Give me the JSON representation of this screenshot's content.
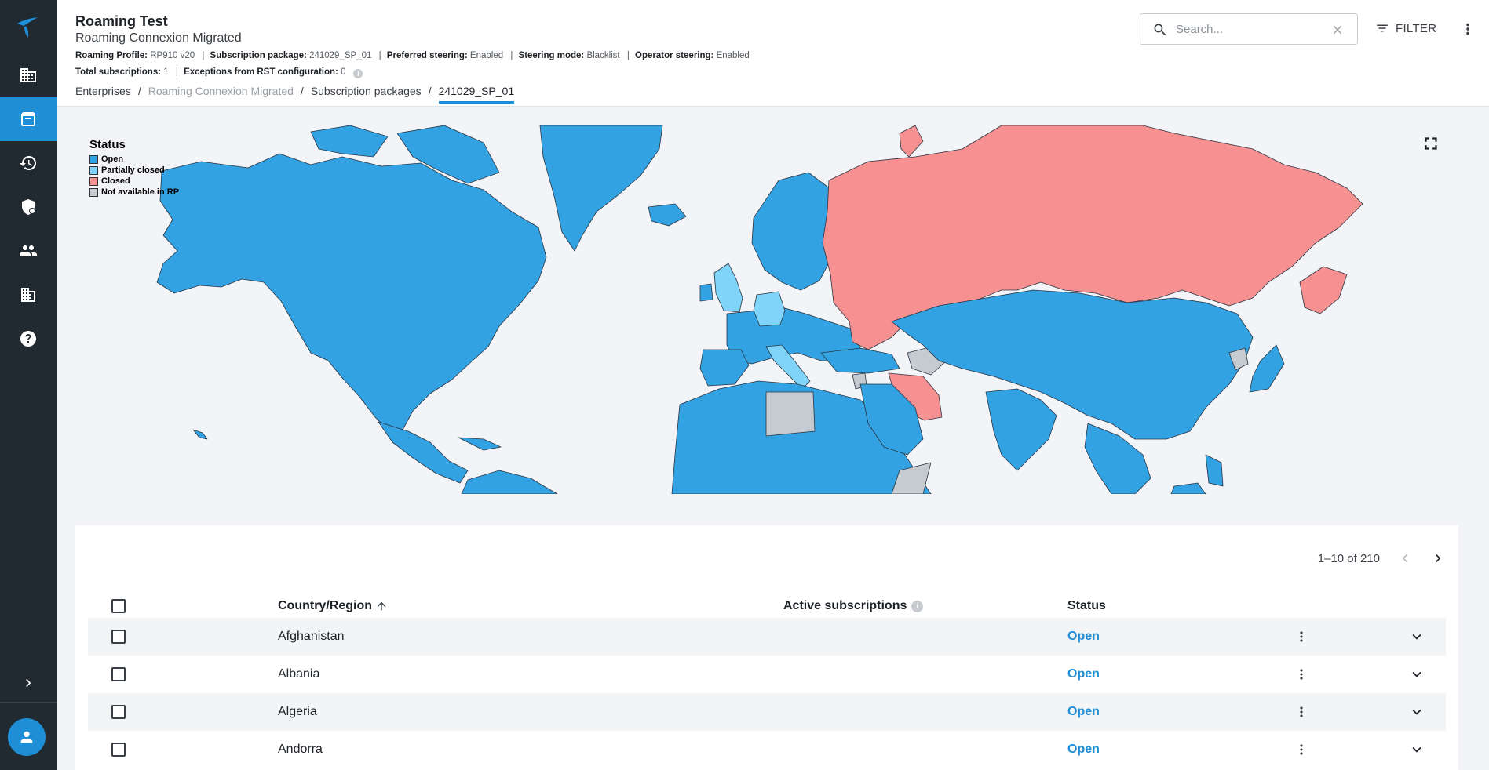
{
  "header": {
    "title": "Roaming Test",
    "subtitle": "Roaming Connexion Migrated",
    "meta": {
      "roaming_profile_label": "Roaming Profile:",
      "roaming_profile_value": "RP910 v20",
      "subscription_package_label": "Subscription package:",
      "subscription_package_value": "241029_SP_01",
      "preferred_steering_label": "Preferred steering:",
      "preferred_steering_value": "Enabled",
      "steering_mode_label": "Steering mode:",
      "steering_mode_value": "Blacklist",
      "operator_steering_label": "Operator steering:",
      "operator_steering_value": "Enabled",
      "total_subscriptions_label": "Total subscriptions:",
      "total_subscriptions_value": "1",
      "exceptions_label": "Exceptions from RST configuration:",
      "exceptions_value": "0",
      "separator": "|"
    },
    "breadcrumbs": [
      "Enterprises",
      "Roaming Connexion Migrated",
      "Subscription packages",
      "241029_SP_01"
    ],
    "breadcrumb_separator": "/",
    "search": {
      "placeholder": "Search...",
      "value": ""
    },
    "filter_label": "FILTER"
  },
  "sidebar": {
    "items": [
      {
        "icon": "building-icon",
        "active": false
      },
      {
        "icon": "package-icon",
        "active": true
      },
      {
        "icon": "history-icon",
        "active": false
      },
      {
        "icon": "shield-icon",
        "active": false
      },
      {
        "icon": "users-icon",
        "active": false
      },
      {
        "icon": "buildings-icon",
        "active": false
      },
      {
        "icon": "help-icon",
        "active": false
      }
    ]
  },
  "map": {
    "legend": {
      "title": "Status",
      "items": [
        {
          "label": "Open",
          "color": "#33a2e3"
        },
        {
          "label": "Partially closed",
          "color": "#80d4fa"
        },
        {
          "label": "Closed",
          "color": "#f79091"
        },
        {
          "label": "Not available in RP",
          "color": "#c6cbd1"
        }
      ]
    }
  },
  "table": {
    "pagination": "1–10 of 210",
    "columns": [
      "Country/Region",
      "Active subscriptions",
      "Status"
    ],
    "rows": [
      {
        "country": "Afghanistan",
        "active": "",
        "status": "Open"
      },
      {
        "country": "Albania",
        "active": "",
        "status": "Open"
      },
      {
        "country": "Algeria",
        "active": "",
        "status": "Open"
      },
      {
        "country": "Andorra",
        "active": "",
        "status": "Open"
      }
    ]
  },
  "colors": {
    "accent": "#1e8ed6",
    "sidebar": "#212931",
    "open": "#33a2e3",
    "partially_closed": "#80d4fa",
    "closed": "#f79091",
    "not_available": "#c6cbd1"
  }
}
